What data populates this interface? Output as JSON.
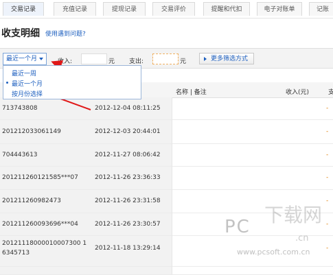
{
  "tabs": [
    "交易记录",
    "充值记录",
    "提现记录",
    "交易评价",
    "提醒和代扣",
    "电子对账单",
    "记账"
  ],
  "page": {
    "title": "收支明细",
    "help_link": "使用遇到问题?"
  },
  "filter": {
    "period_selected": "最近一个月",
    "income_label": "收入:",
    "income_unit": "元",
    "expense_label": "支出:",
    "expense_unit": "元",
    "more_filter": "更多筛选方式"
  },
  "dropdown": {
    "options": [
      "最近一周",
      "最近一个月",
      "按月份选择"
    ],
    "selected_index": 1
  },
  "table": {
    "headers": [
      "名称 | 备注",
      "收入(元)",
      "支"
    ],
    "rows": [
      {
        "id": "713743808",
        "date": "2012-12-04 08:11:25"
      },
      {
        "id": "201212033061149",
        "date": "2012-12-03 20:44:01"
      },
      {
        "id": "704443613",
        "date": "2012-11-27 08:06:42"
      },
      {
        "id": "201211260121585***07",
        "date": "2012-11-26 23:36:33"
      },
      {
        "id": "201211260982473",
        "date": "2012-11-26 23:31:58"
      },
      {
        "id": "201211260093696***04",
        "date": "2012-11-26 23:30:57"
      },
      {
        "id_line1": "20121118000010007300 1",
        "id_line2": "6345713",
        "date": "2012-11-18 13:29:14"
      }
    ]
  },
  "watermark": {
    "brand_pc": "PC",
    "brand_cn": "下载网",
    "url": "www.pcsoft.com.cn",
    "suffix": ".cn"
  },
  "colors": {
    "link_blue": "#1d5fbf",
    "annotation_red": "#e01818",
    "accent_orange": "#e07b00"
  }
}
